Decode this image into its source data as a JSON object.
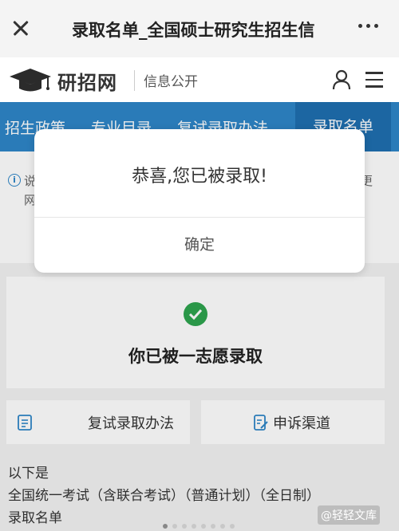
{
  "topbar": {
    "title": "录取名单_全国硕士研究生招生信",
    "close_icon": "close-icon",
    "more_icon": "more-icon"
  },
  "header": {
    "brand": "研招网",
    "sub_brand": "信息公开",
    "logo_icon": "graduation-cap-icon"
  },
  "nav": {
    "tabs": [
      {
        "label": "招生政策"
      },
      {
        "label": "专业目录"
      },
      {
        "label": "复试录取办法"
      },
      {
        "label": "录取名单"
      }
    ],
    "active_index": 3
  },
  "notice": {
    "line1": "说",
    "line2": "网",
    "line1_end": "更"
  },
  "dialog": {
    "message": "恭喜,您已被录取!",
    "confirm_label": "确定"
  },
  "result": {
    "status_text": "你已被一志愿录取"
  },
  "buttons": {
    "retest_label": "复试录取办法",
    "appeal_label": "申诉渠道"
  },
  "description": {
    "line1": "以下是",
    "line2": "全国统一考试（含联合考试）（普通计划）（全日制）",
    "line3": "录取名单"
  },
  "watermark": "@轻轻文库",
  "colors": {
    "primary_blue": "#2e86c8",
    "active_tab": "#1f6fb0",
    "success_green": "#2ea44f"
  },
  "pagination": {
    "total": 8,
    "current": 1
  }
}
